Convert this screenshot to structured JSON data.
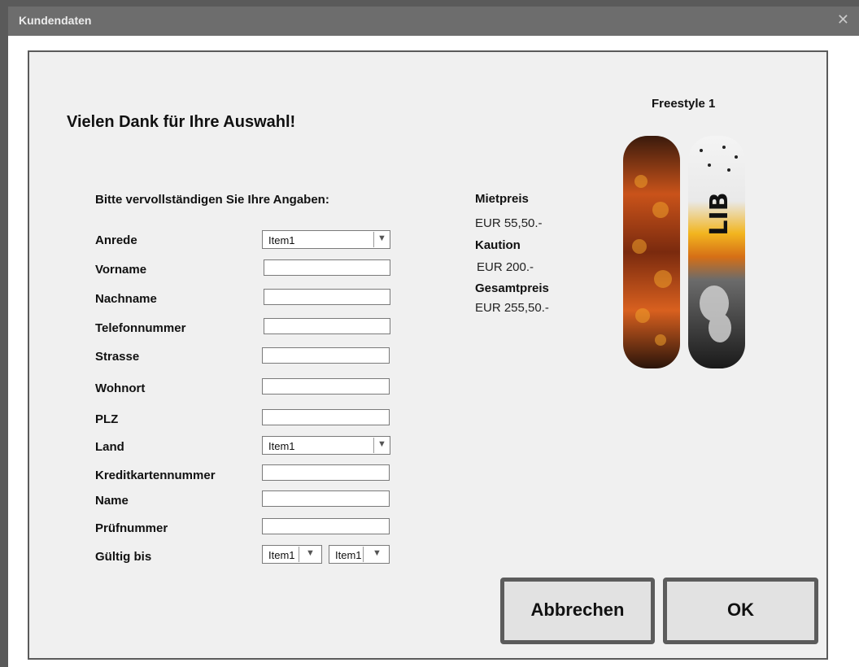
{
  "window": {
    "title": "Kundendaten",
    "close_glyph": "✕"
  },
  "main": {
    "heading": "Vielen Dank für Ihre Auswahl!",
    "form_title": "Bitte vervollständigen Sie Ihre Angaben:"
  },
  "form": {
    "anrede": {
      "label": "Anrede",
      "value": "Item1"
    },
    "vorname": {
      "label": "Vorname",
      "value": ""
    },
    "nachname": {
      "label": "Nachname",
      "value": ""
    },
    "telefonnummer": {
      "label": "Telefonnummer",
      "value": ""
    },
    "strasse": {
      "label": "Strasse",
      "value": ""
    },
    "wohnort": {
      "label": "Wohnort",
      "value": ""
    },
    "plz": {
      "label": "PLZ",
      "value": ""
    },
    "land": {
      "label": "Land",
      "value": "Item1"
    },
    "kreditkartennummer": {
      "label": "Kreditkartennummer",
      "value": ""
    },
    "name": {
      "label": "Name",
      "value": ""
    },
    "pruefnummer": {
      "label": "Prüfnummer",
      "value": ""
    },
    "gueltig_bis": {
      "label": "Gültig bis",
      "month_value": "Item1",
      "year_value": "Item1"
    }
  },
  "pricing": {
    "mietpreis_label": "Mietpreis",
    "mietpreis_value": "EUR 55,50.-",
    "kaution_label": "Kaution",
    "kaution_value": "EUR 200.-",
    "gesamtpreis_label": "Gesamtpreis",
    "gesamtpreis_value": "EUR 255,50.-"
  },
  "product": {
    "title": "Freestyle 1",
    "board_text": "LIB"
  },
  "buttons": {
    "cancel": "Abbrechen",
    "ok": "OK"
  },
  "icons": {
    "dropdown": "chevron-down-icon",
    "close": "close-icon"
  },
  "colors": {
    "titlebar": "#6d6d6d",
    "panel_border": "#5b5b5b",
    "button_border": "#5c5c5c",
    "button_fill": "#e2e2e2"
  }
}
